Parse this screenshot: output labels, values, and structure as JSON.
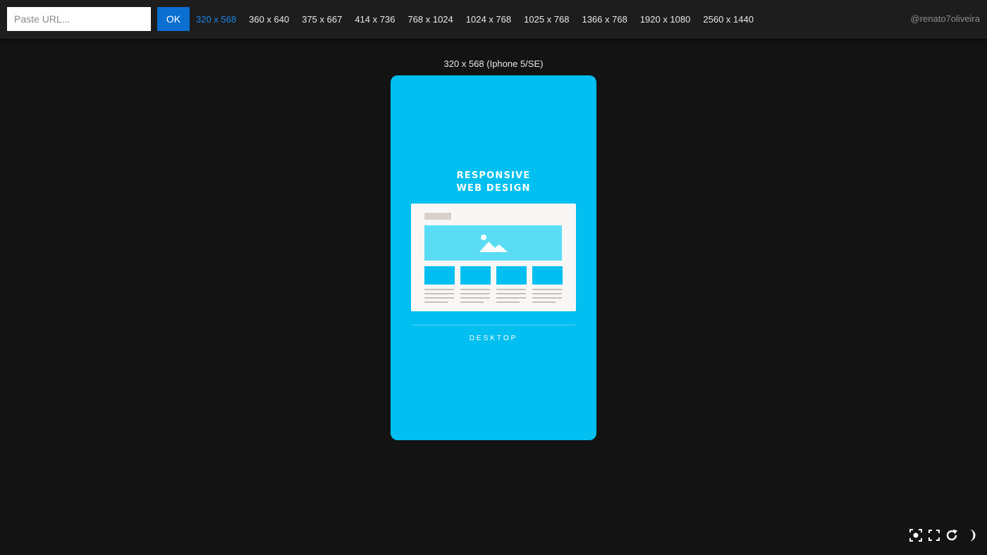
{
  "toolbar": {
    "url_placeholder": "Paste URL...",
    "ok_label": "OK",
    "sizes": [
      {
        "label": "320 x 568",
        "active": true
      },
      {
        "label": "360 x 640",
        "active": false
      },
      {
        "label": "375 x 667",
        "active": false
      },
      {
        "label": "414 x 736",
        "active": false
      },
      {
        "label": "768 x 1024",
        "active": false
      },
      {
        "label": "1024 x 768",
        "active": false
      },
      {
        "label": "1025 x 768",
        "active": false
      },
      {
        "label": "1366 x 768",
        "active": false
      },
      {
        "label": "1920 x 1080",
        "active": false
      },
      {
        "label": "2560 x 1440",
        "active": false
      }
    ],
    "author": "@renato7oliveira"
  },
  "device": {
    "label": "320 x 568 (Iphone 5/SE)",
    "content": {
      "title_line1": "RESPONSIVE",
      "title_line2": "WEB DESIGN",
      "caption": "DESKTOP"
    }
  },
  "tools": {
    "icons": [
      "screenshot-icon",
      "fullscreen-icon",
      "reload-icon",
      "theme-toggle-icon"
    ]
  },
  "colors": {
    "accent": "#0a6fd1",
    "active_size": "#1a86e6",
    "device_bg": "#01bff0",
    "page_bg": "#131313",
    "topbar_bg": "#1d1d1d"
  }
}
